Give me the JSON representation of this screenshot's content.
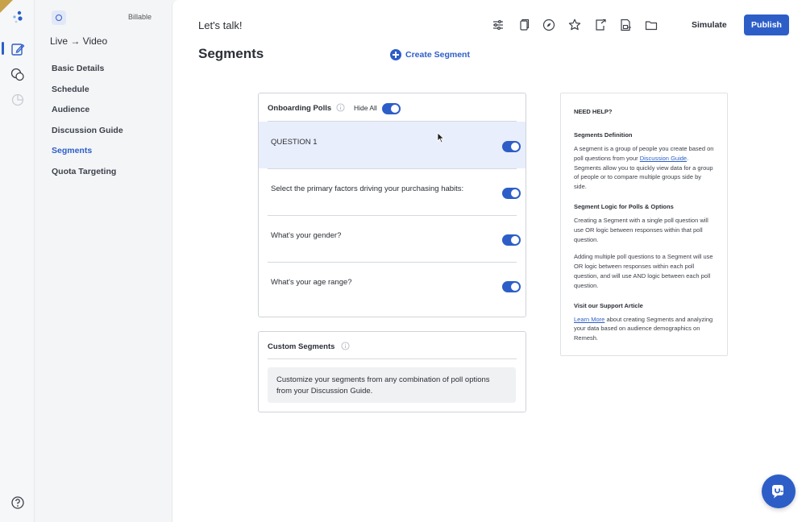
{
  "sidebar": {
    "billable": "Billable",
    "project": "Live → Video",
    "items": [
      {
        "label": "Basic Details"
      },
      {
        "label": "Schedule"
      },
      {
        "label": "Audience"
      },
      {
        "label": "Discussion Guide"
      },
      {
        "label": "Segments",
        "active": true
      },
      {
        "label": "Quota Targeting"
      }
    ]
  },
  "header": {
    "title": "Let's talk!",
    "toolbar_icons": [
      "sliders-icon",
      "copy-icon",
      "compass-icon",
      "star-icon",
      "export-icon",
      "save-icon",
      "folder-icon"
    ],
    "simulate_label": "Simulate",
    "publish_label": "Publish"
  },
  "page": {
    "title": "Segments",
    "create_segment_label": "Create Segment"
  },
  "onboarding_polls": {
    "title": "Onboarding Polls",
    "hide_all_label": "Hide All",
    "hide_all_on": true,
    "questions": [
      {
        "text": "QUESTION 1",
        "enabled": true
      },
      {
        "text": "Select the primary factors driving your purchasing habits:",
        "enabled": true
      },
      {
        "text": "What's your gender?",
        "enabled": true
      },
      {
        "text": "What's your age range?",
        "enabled": true
      }
    ]
  },
  "custom_segments": {
    "title": "Custom Segments",
    "note_line1": "Customize your segments from any combination of poll options",
    "note_line2": "from your Discussion Guide."
  },
  "help": {
    "title": "NEED HELP?",
    "sec1_title": "Segments Definition",
    "sec1_a": "A segment is a group of people you create based on poll questions from your ",
    "sec1_link": "Discussion Guide",
    "sec1_b": ". Segments allow you to quickly view data for a group of people or to compare multiple groups side by side.",
    "sec2_title": "Segment Logic for Polls & Options",
    "sec2_p1": "Creating a Segment with a single poll question will use OR logic between responses within that poll question.",
    "sec2_p2": "Adding multiple poll questions to a Segment will use OR logic between responses within each poll question, and will use AND logic between each poll question.",
    "sec3_title": "Visit our Support Article",
    "sec3_link": "Learn More",
    "sec3_b": " about creating Segments and analyzing your data based on audience demographics on Remesh."
  },
  "colors": {
    "accent": "#2d5ec8",
    "highlight_row": "#e8eefb"
  }
}
